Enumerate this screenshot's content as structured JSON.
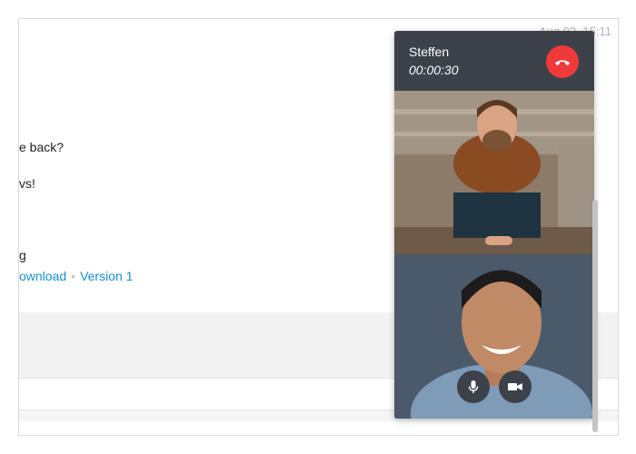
{
  "chat": {
    "timestamp": "Aug 02, 15:11",
    "lines": [
      "e back?",
      "vs!",
      "g"
    ],
    "links": {
      "download": "ownload",
      "separator": "•",
      "version": "Version 1"
    }
  },
  "call": {
    "caller_name": "Steffen",
    "duration": "00:00:30"
  },
  "colors": {
    "call_panel": "#3d414a",
    "hangup": "#f03a3a",
    "link": "#1a8fd0"
  },
  "icons": {
    "hangup": "phone-hangup-icon",
    "mic": "microphone-icon",
    "camera": "video-camera-icon"
  }
}
